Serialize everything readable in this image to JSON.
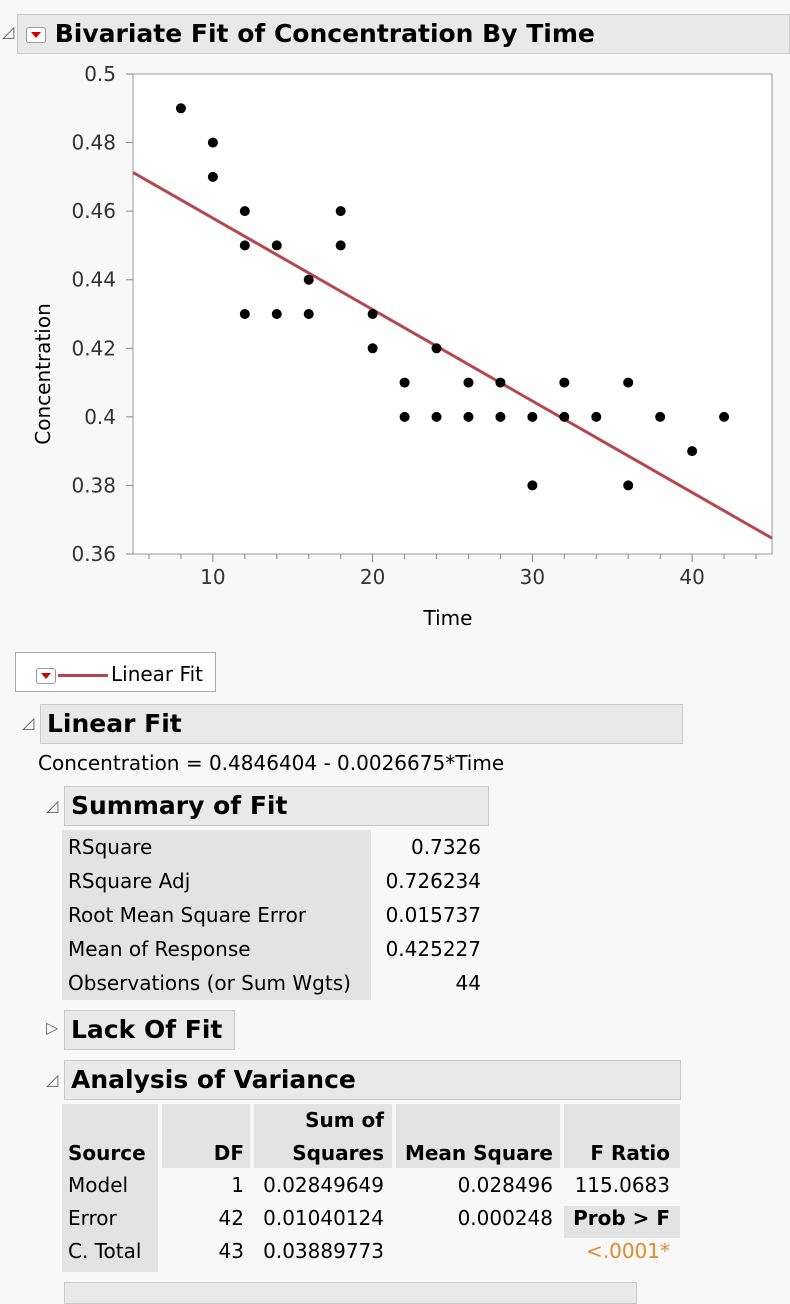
{
  "report_title": "Bivariate Fit of Concentration By Time",
  "chart_data": {
    "type": "scatter",
    "xlabel": "Time",
    "ylabel": "Concentration",
    "xlim": [
      5,
      45
    ],
    "ylim": [
      0.36,
      0.5
    ],
    "xticks": [
      10,
      20,
      30,
      40
    ],
    "yticks": [
      0.36,
      0.38,
      0.4,
      0.42,
      0.44,
      0.46,
      0.48,
      0.5
    ],
    "ytick_labels": [
      "0.36",
      "0.38",
      "0.4",
      "0.42",
      "0.44",
      "0.46",
      "0.48",
      "0.5"
    ],
    "points": [
      [
        8,
        0.49
      ],
      [
        10,
        0.48
      ],
      [
        10,
        0.47
      ],
      [
        12,
        0.46
      ],
      [
        12,
        0.45
      ],
      [
        12,
        0.43
      ],
      [
        14,
        0.45
      ],
      [
        14,
        0.43
      ],
      [
        16,
        0.44
      ],
      [
        16,
        0.43
      ],
      [
        18,
        0.46
      ],
      [
        18,
        0.45
      ],
      [
        20,
        0.43
      ],
      [
        20,
        0.42
      ],
      [
        22,
        0.41
      ],
      [
        22,
        0.4
      ],
      [
        24,
        0.42
      ],
      [
        24,
        0.4
      ],
      [
        26,
        0.41
      ],
      [
        26,
        0.4
      ],
      [
        28,
        0.41
      ],
      [
        28,
        0.4
      ],
      [
        30,
        0.4
      ],
      [
        30,
        0.38
      ],
      [
        32,
        0.41
      ],
      [
        32,
        0.4
      ],
      [
        34,
        0.4
      ],
      [
        36,
        0.41
      ],
      [
        36,
        0.38
      ],
      [
        38,
        0.4
      ],
      [
        40,
        0.39
      ],
      [
        42,
        0.4
      ]
    ],
    "fit_line": {
      "intercept": 0.4846404,
      "slope": -0.0026675,
      "color": "#b5484e"
    },
    "grid": false
  },
  "legend": {
    "label": "Linear Fit"
  },
  "linear_fit": {
    "title": "Linear Fit",
    "equation": "Concentration = 0.4846404 - 0.0026675*Time"
  },
  "summary_of_fit": {
    "title": "Summary of Fit",
    "rows": [
      {
        "label": "RSquare",
        "value": "0.7326"
      },
      {
        "label": "RSquare Adj",
        "value": "0.726234"
      },
      {
        "label": "Root Mean Square Error",
        "value": "0.015737"
      },
      {
        "label": "Mean of Response",
        "value": "0.425227"
      },
      {
        "label": "Observations (or Sum Wgts)",
        "value": "44"
      }
    ]
  },
  "lack_of_fit": {
    "title": "Lack Of Fit"
  },
  "anova": {
    "title": "Analysis of Variance",
    "headers": {
      "source": "Source",
      "df": "DF",
      "ss1": "Sum of",
      "ss2": "Squares",
      "ms": "Mean Square",
      "f": "F Ratio"
    },
    "rows": [
      {
        "source": "Model",
        "df": "1",
        "ss": "0.02849649",
        "ms": "0.028496",
        "f": "115.0683"
      },
      {
        "source": "Error",
        "df": "42",
        "ss": "0.01040124",
        "ms": "0.000248",
        "f": "Prob > F"
      },
      {
        "source": "C. Total",
        "df": "43",
        "ss": "0.03889773",
        "ms": "",
        "f": "<.0001*"
      }
    ],
    "pvalue_color": "#e08a2c"
  }
}
